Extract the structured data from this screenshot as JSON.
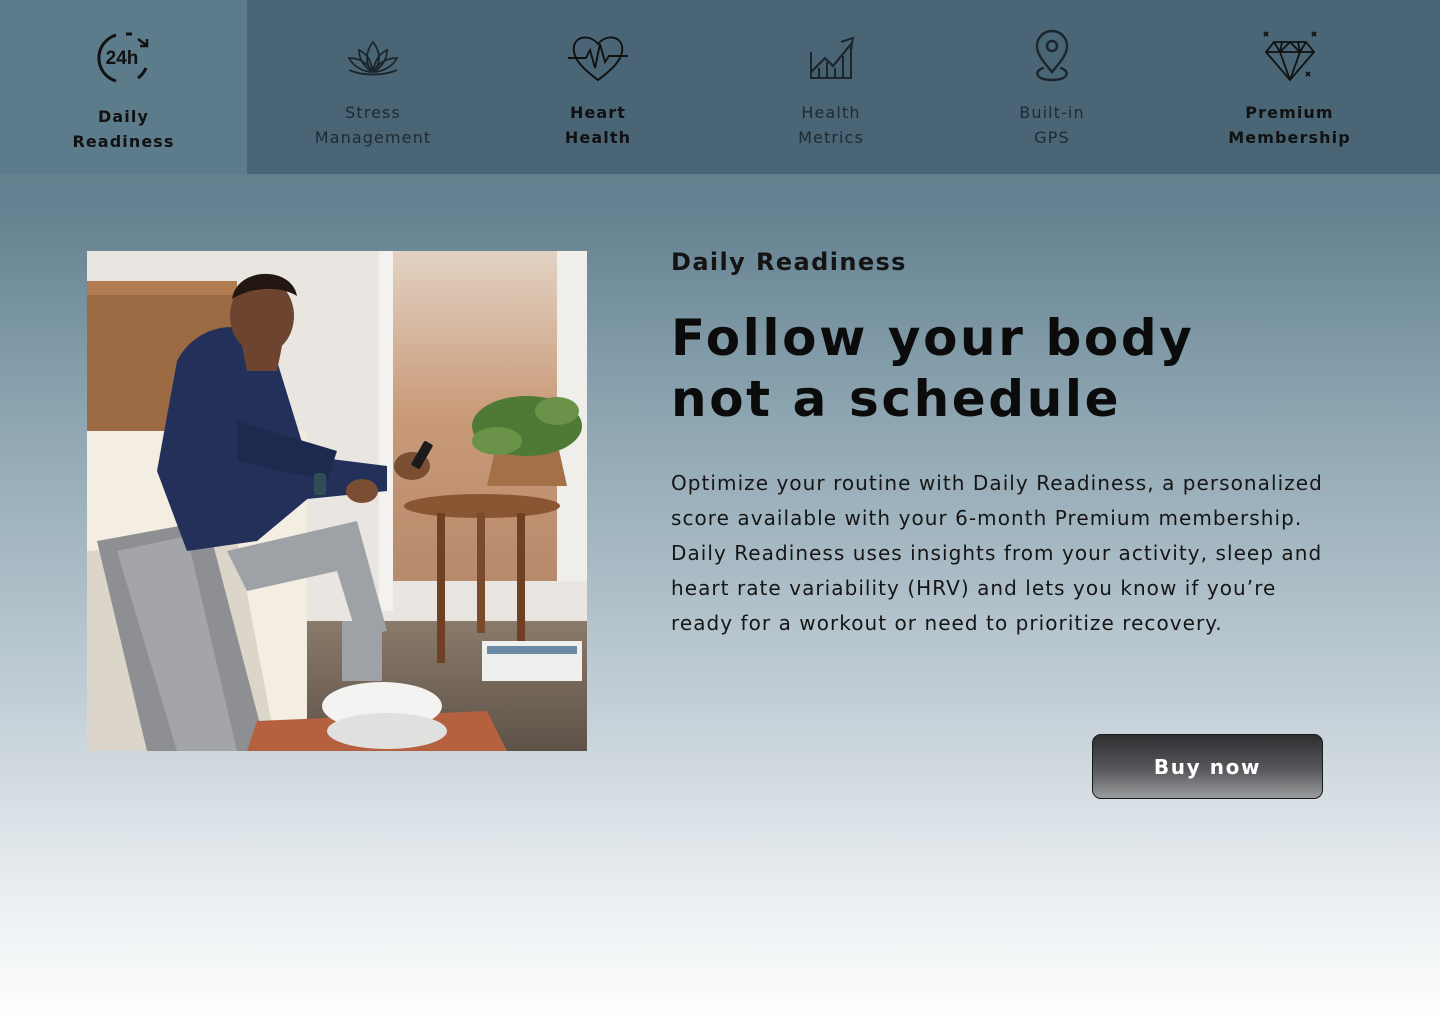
{
  "tabs": [
    {
      "icon": "24h-cycle-icon",
      "label": "Daily\nReadiness",
      "active": true
    },
    {
      "icon": "lotus-icon",
      "label": "Stress\nManagement",
      "active": false
    },
    {
      "icon": "heart-pulse-icon",
      "label": "Heart\nHealth",
      "active": false
    },
    {
      "icon": "trend-chart-icon",
      "label": "Health\nMetrics",
      "active": false
    },
    {
      "icon": "location-pin-icon",
      "label": "Built-in\nGPS",
      "active": false
    },
    {
      "icon": "diamond-icon",
      "label": "Premium\nMembership",
      "active": false
    }
  ],
  "tab_icon_text": "24h",
  "feature": {
    "eyebrow": "Daily Readiness",
    "headline_lines": [
      "Follow your body",
      "not a schedule"
    ],
    "body_lines": [
      "Optimize your routine with Daily Readiness, a personalized",
      "score available with your 6-month Premium membership.",
      "Daily Readiness uses insights from your activity, sleep and",
      "heart rate variability (HRV) and lets you know if you’re",
      "ready for a workout or need to prioritize recovery."
    ],
    "cta_label": "Buy now"
  },
  "colors": {
    "tabbar": "#4a6676",
    "tab_active": "#5d7c8b",
    "cta_top": "#2e2f31",
    "cta_bottom": "#9a9c9e"
  }
}
